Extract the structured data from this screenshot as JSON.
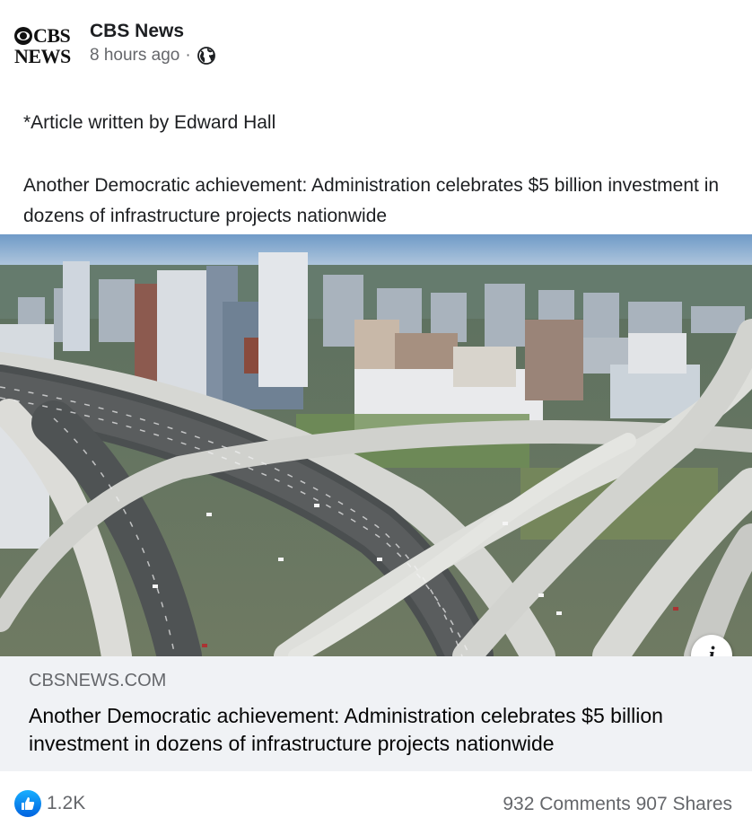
{
  "header": {
    "logo_line1": "CBS",
    "logo_line2": "NEWS",
    "page_name": "CBS News",
    "timestamp": "8 hours ago",
    "separator": "·",
    "audience_icon": "globe-icon"
  },
  "post": {
    "byline": "*Article written by Edward Hall",
    "text": "Another Democratic achievement: Administration celebrates $5 billion investment in dozens of infrastructure projects nationwide"
  },
  "link_preview": {
    "image_icon": "info-icon",
    "domain": "CBSNEWS.COM",
    "title": "Another Democratic achievement: Administration celebrates $5 billion investment in dozens of infrastructure projects nationwide"
  },
  "footer": {
    "reaction_icon": "like-icon",
    "reaction_count": "1.2K",
    "comments_shares": "932 Comments 907 Shares"
  },
  "colors": {
    "accent": "#1877f2",
    "secondary_text": "#65676b",
    "link_box_bg": "#f0f2f5"
  }
}
